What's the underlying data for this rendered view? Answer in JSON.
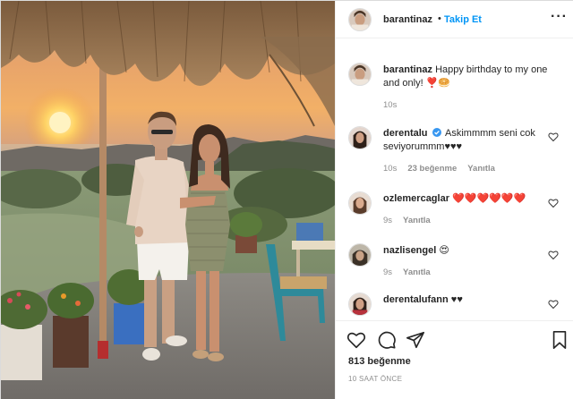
{
  "post": {
    "author": "barantinaz",
    "follow_label": "Takip Et",
    "separator": "•",
    "more_label": "···",
    "accent": "#0095f6"
  },
  "caption": {
    "username": "barantinaz",
    "text": "Happy birthday to my one and only! ❣️🥯",
    "time": "10s"
  },
  "comments": [
    {
      "username": "derentalu",
      "verified": true,
      "text": "Askimmmm seni cok seviyorummm♥♥♥",
      "time": "10s",
      "likes": "23 beğenme",
      "reply": "Yanıtla"
    },
    {
      "username": "ozlemercaglar",
      "verified": false,
      "text": "❤️❤️❤️❤️❤️❤️",
      "time": "9s",
      "likes": "",
      "reply": "Yanıtla"
    },
    {
      "username": "nazlisengel",
      "verified": false,
      "text": "😍",
      "time": "9s",
      "likes": "",
      "reply": "Yanıtla"
    },
    {
      "username": "derentalufann",
      "verified": false,
      "text": "♥♥",
      "time": "",
      "likes": "",
      "reply": ""
    }
  ],
  "actions": {
    "icons": [
      "heart-icon",
      "comment-icon",
      "share-icon",
      "bookmark-icon"
    ],
    "likes_count": "813 beğenme",
    "time_ago": "10 SAAT ÖNCE"
  }
}
